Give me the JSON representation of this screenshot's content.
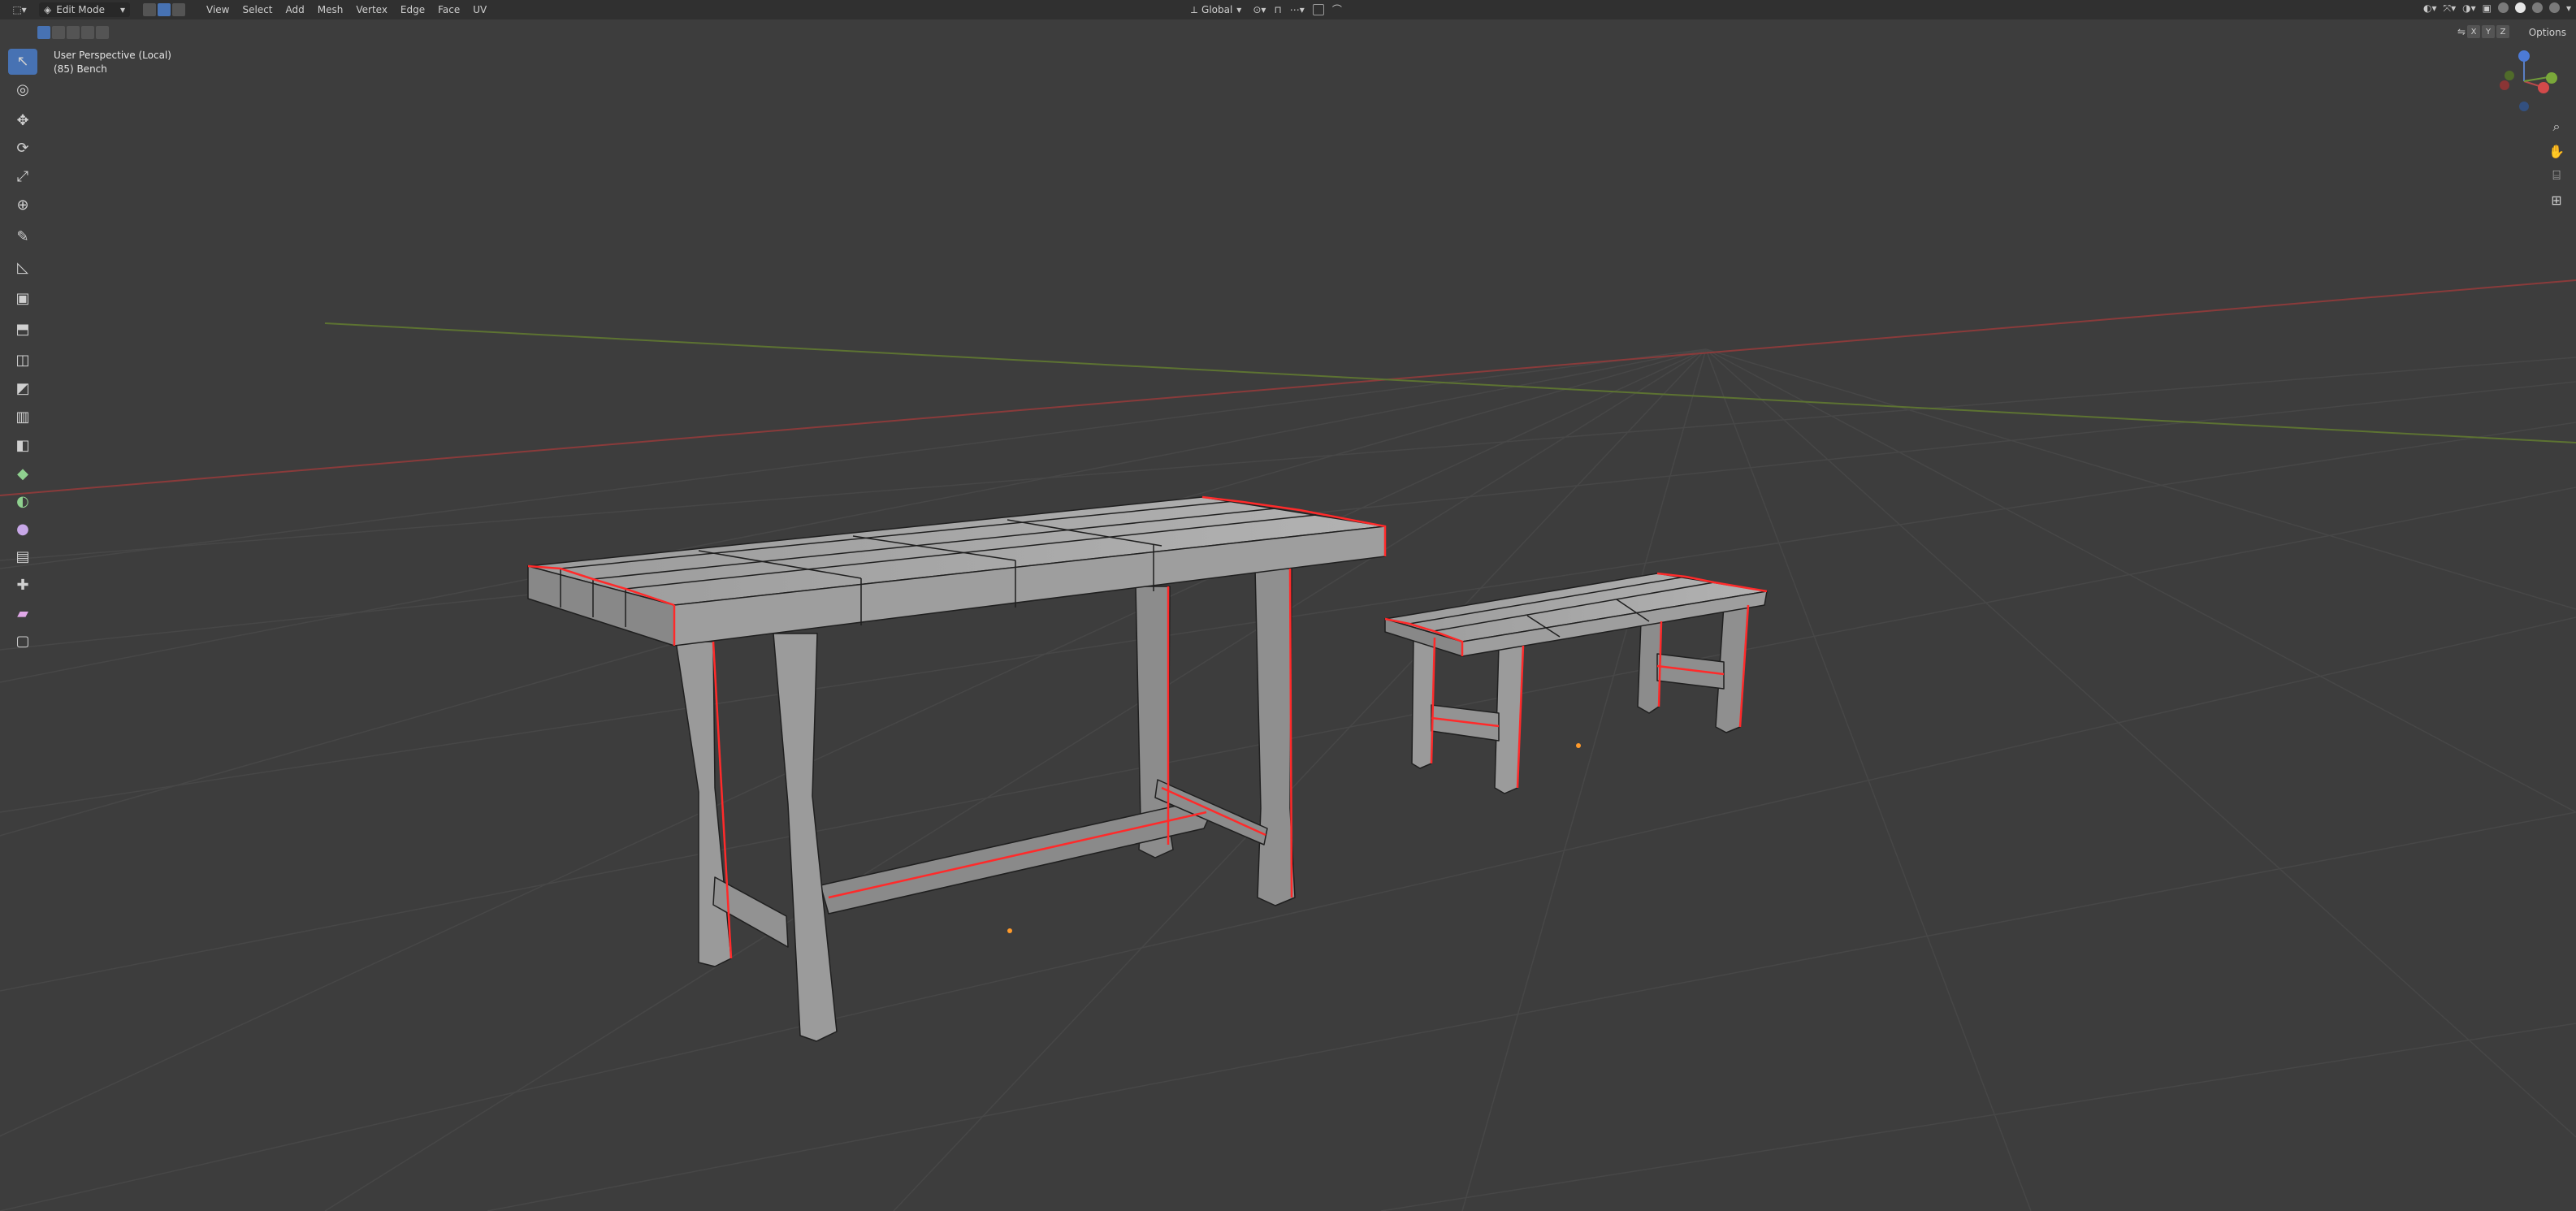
{
  "header": {
    "mode": "Edit Mode",
    "menus": [
      "View",
      "Select",
      "Add",
      "Mesh",
      "Vertex",
      "Edge",
      "Face",
      "UV"
    ],
    "orientation": "Global",
    "options_label": "Options",
    "axis_toggles": [
      "X",
      "Y",
      "Z"
    ]
  },
  "viewport": {
    "perspective_label": "User Perspective (Local)",
    "object_label": "(85) Bench"
  },
  "colors": {
    "background": "#3d3d3d",
    "header": "#303030",
    "accent": "#4772b3",
    "seam": "#ff2a2a",
    "mesh": "#9a9a9a",
    "wire": "#1c1c1c",
    "axis_x": "#b84a4a",
    "axis_y": "#6f8f3a"
  },
  "toolbar": {
    "tools": [
      {
        "name": "select-box",
        "glyph": "↖",
        "active": true
      },
      {
        "name": "cursor",
        "glyph": "◎"
      },
      {
        "name": "move",
        "glyph": "✥"
      },
      {
        "name": "rotate",
        "glyph": "⟳"
      },
      {
        "name": "scale",
        "glyph": "⤢"
      },
      {
        "name": "transform",
        "glyph": "⊕"
      },
      {
        "name": "annotate",
        "glyph": "✎"
      },
      {
        "name": "measure",
        "glyph": "📐"
      },
      {
        "name": "add-cube",
        "glyph": "▣"
      },
      {
        "name": "extrude",
        "glyph": "⬒"
      },
      {
        "name": "inset",
        "glyph": "◫"
      },
      {
        "name": "bevel",
        "glyph": "◩"
      },
      {
        "name": "loop-cut",
        "glyph": "▥"
      },
      {
        "name": "knife",
        "glyph": "◧"
      },
      {
        "name": "poly-build",
        "glyph": "◆"
      },
      {
        "name": "spin",
        "glyph": "◐"
      },
      {
        "name": "smooth",
        "glyph": "●"
      },
      {
        "name": "edge-slide",
        "glyph": "▤"
      },
      {
        "name": "shrink-fatten",
        "glyph": "✚"
      },
      {
        "name": "shear",
        "glyph": "▰"
      },
      {
        "name": "rip-region",
        "glyph": "▢"
      }
    ]
  }
}
